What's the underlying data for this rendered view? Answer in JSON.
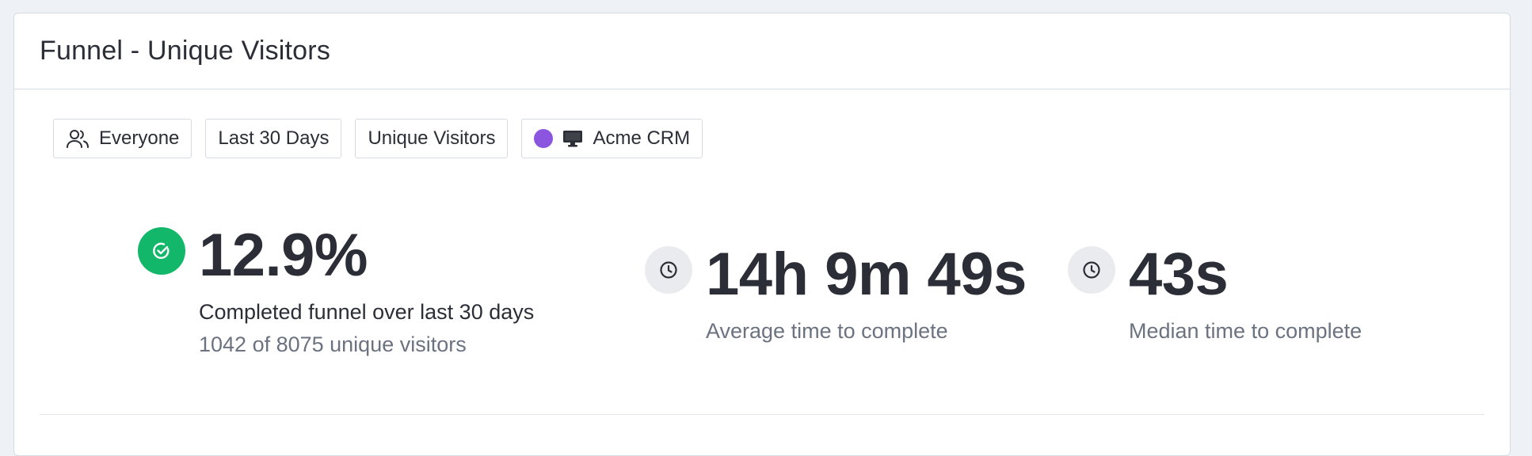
{
  "card": {
    "title": "Funnel - Unique Visitors"
  },
  "filters": [
    {
      "label": "Everyone",
      "icon": "users-icon"
    },
    {
      "label": "Last 30 Days"
    },
    {
      "label": "Unique Visitors"
    },
    {
      "label": "Acme CRM",
      "icon": "monitor-icon",
      "dot_color": "#8b55e0"
    }
  ],
  "stats": {
    "completion": {
      "value": "12.9%",
      "label": "Completed funnel over last 30 days",
      "sub": "1042 of 8075 unique visitors",
      "icon": "check-circle-icon",
      "icon_color": "#12b76a"
    },
    "average": {
      "value": "14h 9m 49s",
      "label": "Average time to complete",
      "icon": "clock-icon"
    },
    "median": {
      "value": "43s",
      "label": "Median time to complete",
      "icon": "clock-icon"
    }
  },
  "colors": {
    "text": "#2b2e36",
    "muted": "#6b7280",
    "border": "#d6dbe2",
    "icon_bg": "#e9ebef"
  }
}
